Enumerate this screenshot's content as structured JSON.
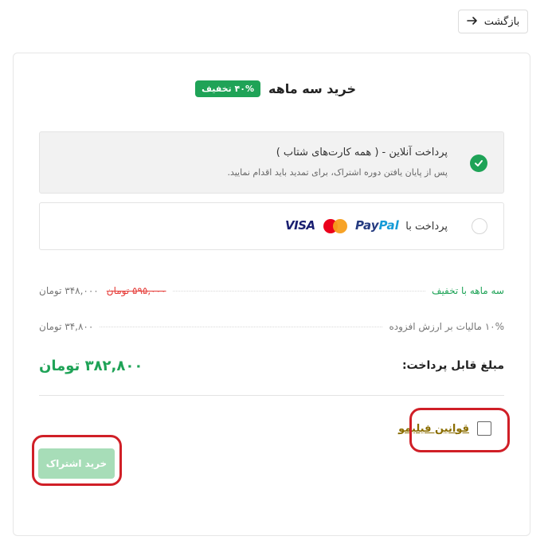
{
  "back_button": {
    "label": "بازگشت",
    "icon": "arrow-right-icon"
  },
  "plan": {
    "title": "خرید سه ماهه",
    "discount_badge": "۴۰% تخفیف"
  },
  "payment_options": [
    {
      "title": "پرداخت آنلاین - ( همه کارت‌های شتاب )",
      "subtitle": "پس از پایان یافتن دوره اشتراک، برای تمدید باید اقدام نمایید.",
      "selected": true
    },
    {
      "label": "پرداخت با",
      "logos": [
        "PayPal",
        "Mastercard",
        "VISA"
      ],
      "selected": false
    }
  ],
  "summary": {
    "discount_row": {
      "label": "سه ماهه با تخفیف",
      "old_price": "۵۹۵,۰۰۰ تومان",
      "price": "۳۴۸,۰۰۰ تومان"
    },
    "tax_row": {
      "label": "۱۰% مالیات بر ارزش افزوده",
      "price": "۳۴,۸۰۰ تومان"
    },
    "total": {
      "label": "مبلغ قابل پرداخت:",
      "value": "۳۸۲,۸۰۰ تومان"
    }
  },
  "terms": {
    "link_label": "قوانین فیلیمو",
    "checked": false
  },
  "buy_button": {
    "label": "خرید اشتراک",
    "enabled": false
  },
  "colors": {
    "accent": "#1fa357",
    "discount_red": "#e53935",
    "highlight": "#d01f27",
    "terms_link": "#8a6d00"
  }
}
